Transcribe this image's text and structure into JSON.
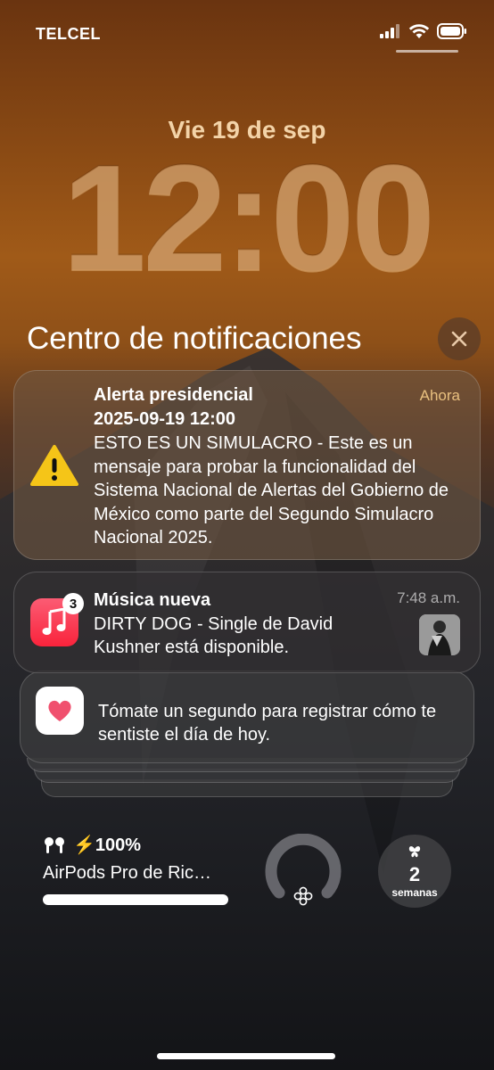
{
  "status_bar": {
    "carrier": "TELCEL",
    "signal_icon": "cellular-signal-icon",
    "wifi_icon": "wifi-icon",
    "battery_icon": "battery-icon"
  },
  "lock_screen": {
    "date": "Vie 19 de sep",
    "time": "12:00"
  },
  "notification_center": {
    "title": "Centro de notificaciones",
    "close_icon": "close-icon"
  },
  "notifications": [
    {
      "app_icon": "warning-icon",
      "title": "Alerta presidencial",
      "time": "Ahora",
      "subtitle": "2025-09-19 12:00",
      "body": "ESTO ES UN SIMULACRO - Este es un mensaje para probar la funcionalidad del Sistema Nacional de Alertas del Gobierno de México como parte del Segundo Simulacro Nacional 2025."
    },
    {
      "app_icon": "music-app-icon",
      "badge": "3",
      "title": "Música nueva",
      "time": "7:48 a.m.",
      "body": "DIRTY DOG - Single de David Kushner está disponible.",
      "thumbnail": "album-art-thumbnail"
    },
    {
      "app_icon": "health-app-icon",
      "body": "Tómate un segundo para registrar cómo te sentiste el día de hoy."
    }
  ],
  "widgets": {
    "airpods": {
      "icon": "airpods-icon",
      "battery": "⚡100%",
      "name": "AirPods Pro de Ric…",
      "level_fraction": 1.0
    },
    "ring": {
      "icon": "mindfulness-icon"
    },
    "weeks": {
      "icon": "butterfly-icon",
      "value": "2",
      "label": "semanas"
    }
  },
  "colors": {
    "accent_date": "#f3d3a8",
    "alert_time": "#e9c07f",
    "music_red": "#fa233b"
  }
}
